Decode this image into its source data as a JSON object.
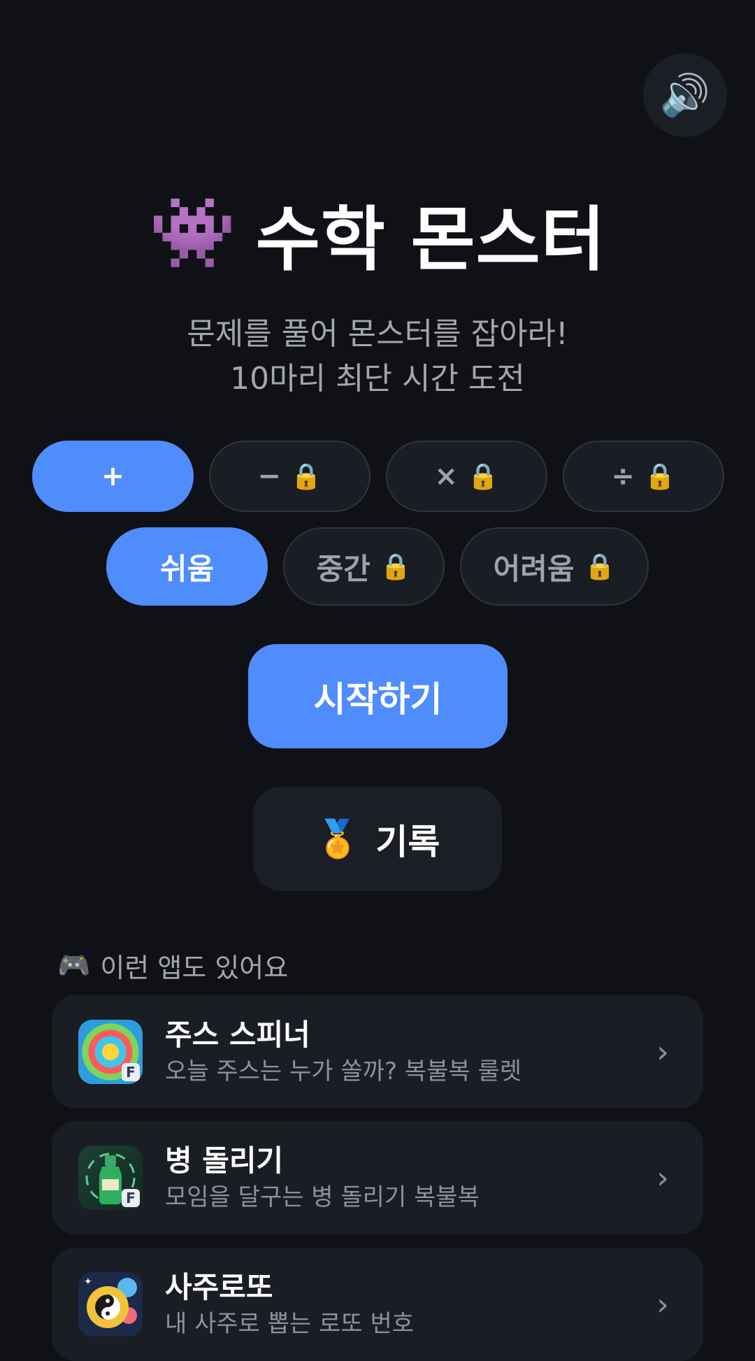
{
  "header": {
    "sound_icon": "🔊"
  },
  "title": {
    "icon": "👾",
    "text": "수학 몬스터"
  },
  "subtitle": {
    "line1": "문제를 풀어 몬스터를 잡아라!",
    "line2": "10마리 최단 시간 도전"
  },
  "operations": [
    {
      "label": "+",
      "locked": false,
      "active": true
    },
    {
      "label": "−",
      "locked": true,
      "active": false
    },
    {
      "label": "×",
      "locked": true,
      "active": false
    },
    {
      "label": "÷",
      "locked": true,
      "active": false
    }
  ],
  "difficulties": [
    {
      "label": "쉬움",
      "locked": false,
      "active": true
    },
    {
      "label": "중간",
      "locked": true,
      "active": false
    },
    {
      "label": "어려움",
      "locked": true,
      "active": false
    }
  ],
  "lock_icon": "🔒",
  "start_label": "시작하기",
  "record": {
    "icon": "🏅",
    "label": "기록"
  },
  "section": {
    "icon": "🎮",
    "title": "이런 앱도 있어요"
  },
  "apps": [
    {
      "name": "주스 스피너",
      "desc": "오늘 주스는 누가 쏠까? 복불복 룰렛",
      "icon": "juice-spinner-icon"
    },
    {
      "name": "병 돌리기",
      "desc": "모임을 달구는 병 돌리기 복불복",
      "icon": "bottle-spin-icon"
    },
    {
      "name": "사주로또",
      "desc": "내 사주로 뽑는 로또 번호",
      "icon": "saju-lotto-icon"
    }
  ],
  "chevron": "›",
  "colors": {
    "accent": "#4f8dfc",
    "background": "#101116",
    "card": "#1b1d24"
  }
}
